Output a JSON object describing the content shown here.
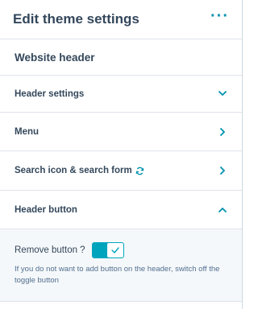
{
  "panel": {
    "title": "Edit theme settings",
    "more_icon": "ellipsis-icon"
  },
  "section_heading": "Website header",
  "rows": [
    {
      "label": "Header settings",
      "icon": "chevron-down-icon"
    },
    {
      "label": "Menu",
      "icon": "chevron-right-icon"
    },
    {
      "label": "Search icon & search form",
      "icon": "chevron-right-icon",
      "extra_icon": "sync-icon"
    },
    {
      "label": "Header button",
      "icon": "chevron-up-icon"
    }
  ],
  "header_button": {
    "toggle_label": "Remove button ?",
    "toggle_on": true,
    "help_text": "If you do not want to add button on the header, switch off the toggle button"
  },
  "colors": {
    "accent": "#0091ae",
    "toggle": "#00a4bd",
    "text": "#33475b",
    "expanded_bg": "#f5f8fa"
  }
}
